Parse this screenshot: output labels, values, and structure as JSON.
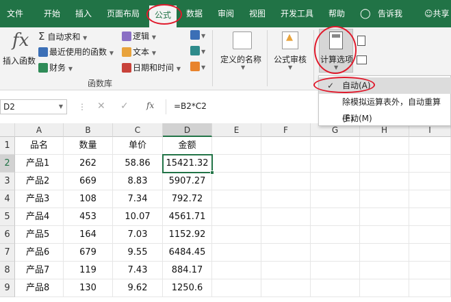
{
  "tabs": [
    "文件",
    "开始",
    "插入",
    "页面布局",
    "公式",
    "数据",
    "审阅",
    "视图",
    "开发工具",
    "帮助",
    "告诉我",
    "共享"
  ],
  "ribbon": {
    "insert_function": "插入函数",
    "autosum": "自动求和",
    "recent": "最近使用的函数",
    "finance": "财务",
    "logical": "逻辑",
    "text": "文本",
    "datetime": "日期和时间",
    "group_label": "函数库",
    "defined_names": "定义的名称",
    "formula_audit": "公式审核",
    "calc_options": "计算选项"
  },
  "menu": {
    "items": [
      "自动(A)",
      "除模拟运算表外，自动重算(E)",
      "手动(M)"
    ]
  },
  "formula_bar": {
    "name_box": "D2",
    "formula": "=B2*C2"
  },
  "sheet": {
    "columns": [
      "A",
      "B",
      "C",
      "D",
      "E",
      "F",
      "G",
      "H",
      "I"
    ],
    "rows": [
      "1",
      "2",
      "3",
      "4",
      "5",
      "6",
      "7",
      "8",
      "9"
    ],
    "header": [
      "品名",
      "数量",
      "单价",
      "金额"
    ],
    "data": [
      [
        "产品1",
        "262",
        "58.86",
        "15421.32"
      ],
      [
        "产品2",
        "669",
        "8.83",
        "5907.27"
      ],
      [
        "产品3",
        "108",
        "7.34",
        "792.72"
      ],
      [
        "产品4",
        "453",
        "10.07",
        "4561.71"
      ],
      [
        "产品5",
        "164",
        "7.03",
        "1152.92"
      ],
      [
        "产品6",
        "679",
        "9.55",
        "6484.45"
      ],
      [
        "产品7",
        "119",
        "7.43",
        "884.17"
      ],
      [
        "产品8",
        "130",
        "9.62",
        "1250.6"
      ]
    ]
  },
  "colors": {
    "excel_green": "#217346",
    "annotation_red": "#e0192b"
  }
}
